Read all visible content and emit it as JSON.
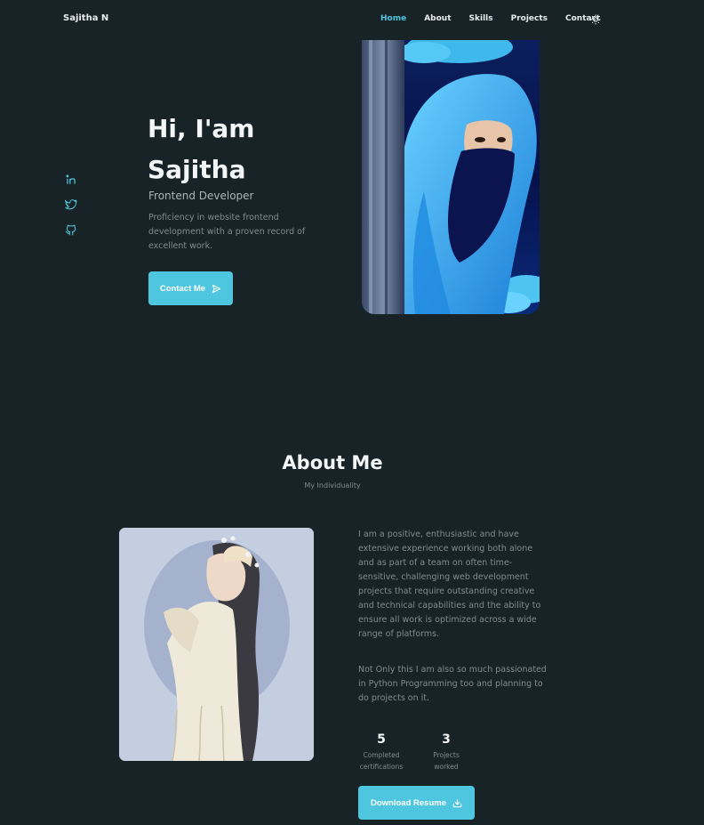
{
  "header": {
    "logo": "Sajitha N",
    "nav": [
      {
        "label": "Home",
        "active": true
      },
      {
        "label": "About",
        "active": false
      },
      {
        "label": "Skills",
        "active": false
      },
      {
        "label": "Projects",
        "active": false
      },
      {
        "label": "Contact",
        "active": false
      }
    ],
    "theme_icon": "sun-icon"
  },
  "social": [
    {
      "icon": "linkedin-icon"
    },
    {
      "icon": "twitter-icon"
    },
    {
      "icon": "github-icon"
    }
  ],
  "hero": {
    "greeting_line1": "Hi, I'am",
    "greeting_line2": "Sajitha",
    "role": "Frontend Developer",
    "description": "Proficiency in website frontend development with a proven record of excellent work.",
    "contact_button": "Contact Me",
    "contact_icon": "send-icon"
  },
  "about": {
    "title": "About Me",
    "subtitle": "My Individuality",
    "paragraph1": "I am a positive, enthusiastic and have extensive experience working both alone and as part of a team on often time-sensitive, challenging web development projects that require outstanding creative and technical capabilities and the ability to ensure all work is optimized across a wide range of platforms.",
    "paragraph2": "Not Only this I am also so much passionated in Python Programming too and planning to do projects on it.",
    "stats": [
      {
        "value": "5",
        "label": "Completed certifications"
      },
      {
        "value": "3",
        "label": "Projects worked"
      }
    ],
    "resume_button": "Download Resume",
    "resume_icon": "download-icon"
  },
  "colors": {
    "background": "#172326",
    "accent": "#4fc6df",
    "text_muted": "#7f8d91"
  }
}
